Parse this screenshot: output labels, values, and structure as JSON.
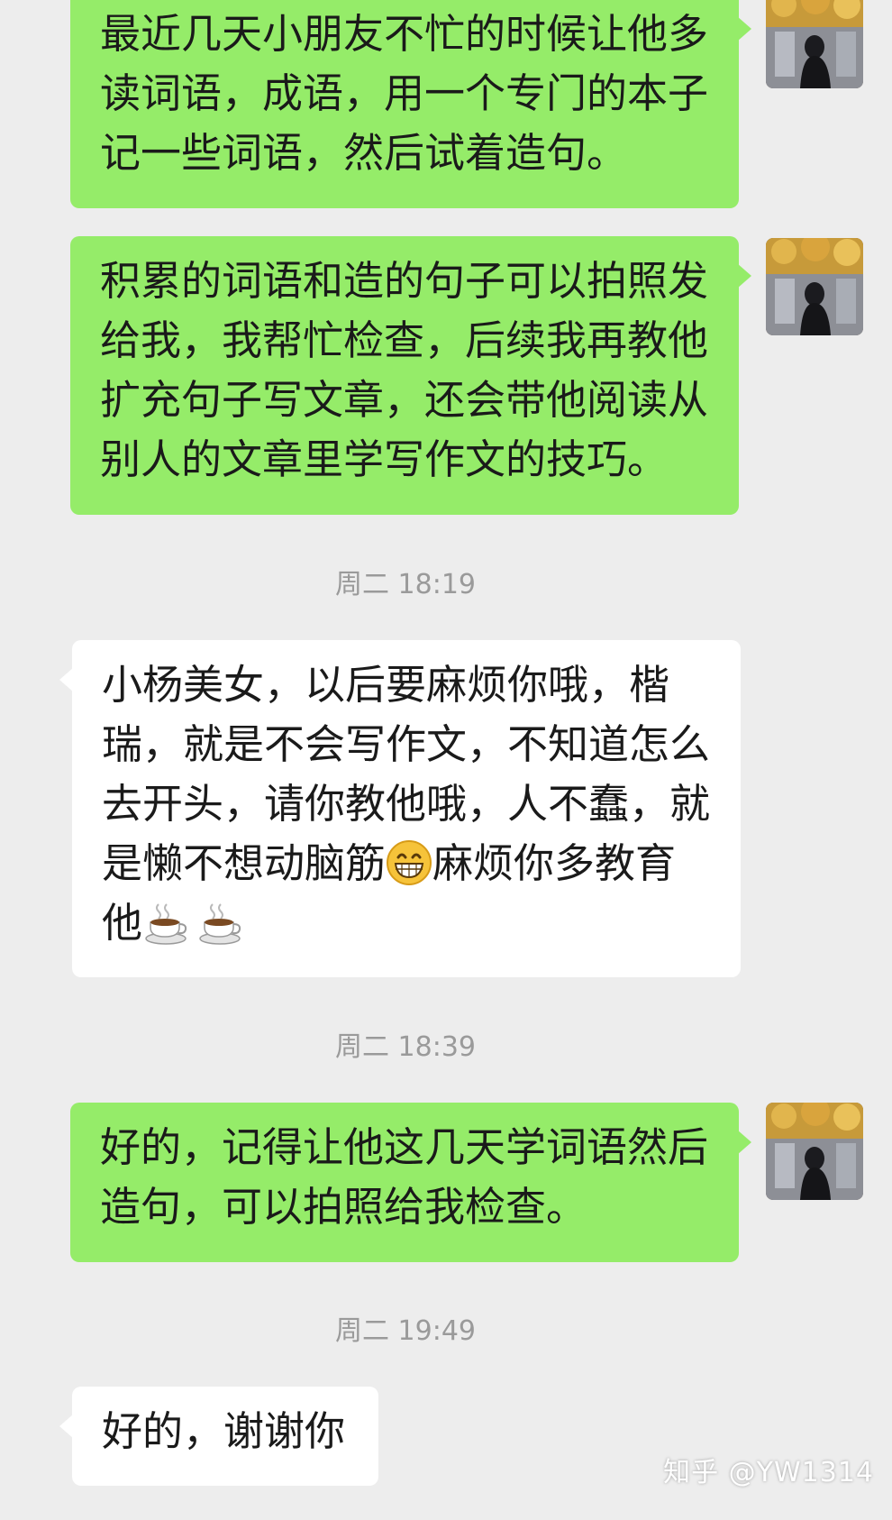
{
  "messages": [
    {
      "lines": [
        "最近几天小朋友不忙的时候让他多",
        "读词语，成语，用一个专门的本子",
        "记一些词语，然后试着造句。"
      ]
    },
    {
      "lines": [
        "积累的词语和造的句子可以拍照发",
        "给我，我帮忙检查，后续我再教他",
        "扩充句子写文章，还会带他阅读从",
        "别人的文章里学写作文的技巧。"
      ]
    },
    {
      "lines": [
        "小杨美女，以后要麻烦你哦，楷",
        "瑞，就是不会写作文，不知道怎么",
        "去开头，请你教他哦，人不蠢，就",
        "是懒不想动脑筋",
        "麻烦你多教育",
        "他"
      ]
    },
    {
      "lines": [
        "好的，记得让他这几天学词语然后",
        "造句，可以拍照给我检查。"
      ]
    },
    {
      "lines": [
        "好的，谢谢你"
      ]
    }
  ],
  "timestamps": [
    "周二 18:19",
    "周二 18:39",
    "周二 19:49"
  ],
  "emojis": {
    "grin": "grinning-face-icon",
    "coffee": "hot-beverage-icon"
  },
  "colors": {
    "background": "#ededed",
    "outgoing_bubble": "#95ec69",
    "incoming_bubble": "#ffffff",
    "timestamp_text": "#9a9a9a"
  },
  "watermark": "知乎 @YW1314"
}
